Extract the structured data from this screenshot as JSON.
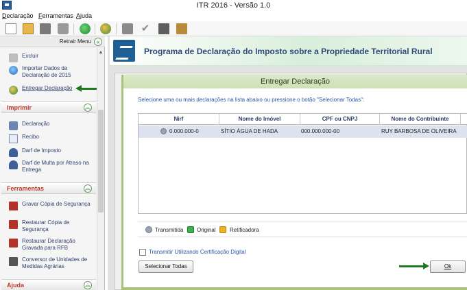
{
  "window": {
    "title": "ITR 2016 - Versão 1.0"
  },
  "menu": {
    "declaracao_hot": "D",
    "declaracao_rest": "eclaração",
    "ferramentas_hot": "F",
    "ferramentas_rest": "erramentas",
    "ajuda_hot": "A",
    "ajuda_rest": "juda"
  },
  "toolbar": {
    "icons": [
      "new-document-icon",
      "open-folder-icon",
      "folder-icon",
      "trash-icon",
      "globe-send-icon",
      "globe-icon",
      "print-icon",
      "check-icon",
      "calculator-icon",
      "book-icon"
    ]
  },
  "sidebar": {
    "retrair_label": "Retrair Menu",
    "collapse_glyph": "«",
    "section_collapse_glyph": "︽",
    "top_items": [
      {
        "label": "Excluir"
      },
      {
        "label": "Importar Dados da Declaração de 2015"
      },
      {
        "label": "Entregar Declaração"
      }
    ],
    "imprimir": {
      "title": "Imprimir",
      "items": [
        {
          "label": "Declaração"
        },
        {
          "label": "Recibo"
        },
        {
          "label": "Darf de Imposto"
        },
        {
          "label": "Darf de Multa por Atraso na Entrega"
        }
      ]
    },
    "ferramentas": {
      "title": "Ferramentas",
      "items": [
        {
          "label": "Gravar Cópia de Segurança"
        },
        {
          "label": "Restaurar Cópia de Segurança"
        },
        {
          "label": "Restaurar Declaração Gravada para RFB"
        },
        {
          "label": "Conversor de Unidades de Medidas Agrárias"
        }
      ]
    },
    "ajuda": {
      "title": "Ajuda"
    }
  },
  "banner": {
    "title": "Programa de Declaração do Imposto sobre a Propriedade Territorial Rural"
  },
  "dialog": {
    "title": "Entregar Declaração",
    "instruction": "Selecione uma ou mais declarações na lista abaixo ou pressione o botão \"Selecionar Todas\":",
    "columns": [
      "Nirf",
      "Nome do Imóvel",
      "CPF ou CNPJ",
      "Nome do Contribuinte"
    ],
    "rows": [
      {
        "nirf": "0.000.000-0",
        "nome_imovel": "SÍTIO ÁGUA DE HADA",
        "cpf_cnpj": "000.000.000-00",
        "contribuinte": "RUY BARBOSA DE OLIVEIRA"
      }
    ],
    "legend": {
      "transmitida": "Transmitida",
      "original": "Original",
      "retificadora": "Retificadora"
    },
    "certificado_label": "Transmitir Utilizando Certificação Digital",
    "certificado_checked": false,
    "select_all_label": "Selecionar Todas",
    "ok_label": "Ok"
  }
}
